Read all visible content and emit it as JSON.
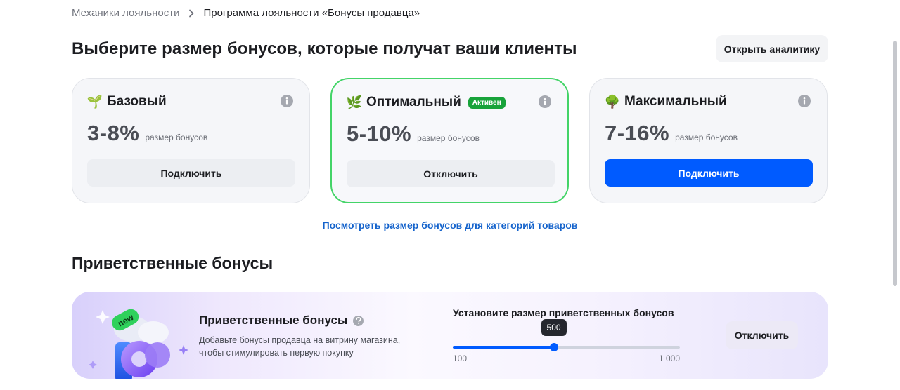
{
  "breadcrumb": {
    "parent": "Механики лояльности",
    "current": "Программа лояльности «Бонусы продавца»"
  },
  "header": {
    "title": "Выберите размер бонусов, которые получат ваши клиенты",
    "analytics_button": "Открыть аналитику"
  },
  "plans": [
    {
      "icon": "seedling-icon",
      "emoji": "🌱",
      "title": "Базовый",
      "badge": "",
      "range": "3-8%",
      "range_label": "размер бонусов",
      "button": "Подключить",
      "active": false,
      "primary": false
    },
    {
      "icon": "herb-icon",
      "emoji": "🌿",
      "title": "Оптимальный",
      "badge": "Активен",
      "range": "5-10%",
      "range_label": "размер бонусов",
      "button": "Отключить",
      "active": true,
      "primary": false
    },
    {
      "icon": "tree-icon",
      "emoji": "🌳",
      "title": "Максимальный",
      "badge": "",
      "range": "7-16%",
      "range_label": "размер бонусов",
      "button": "Подключить",
      "active": false,
      "primary": true
    }
  ],
  "category_link": "Посмотреть размер бонусов для категорий товаров",
  "welcome_section": {
    "heading": "Приветственные бонусы",
    "card_title": "Приветственные бонусы",
    "description": "Добавьте бонусы продавца на витрину магазина, чтобы стимулировать первую покупку",
    "illustration_badge": "new",
    "slider": {
      "label": "Установите размер приветственных бонусов",
      "value": 500,
      "value_label": "500",
      "min": 100,
      "max": 1000,
      "min_label": "100",
      "max_label": "1 000"
    },
    "button": "Отключить"
  },
  "colors": {
    "accent": "#005bff",
    "active_border": "#44d468",
    "active_badge": "#18a33a",
    "link": "#1463cc"
  }
}
